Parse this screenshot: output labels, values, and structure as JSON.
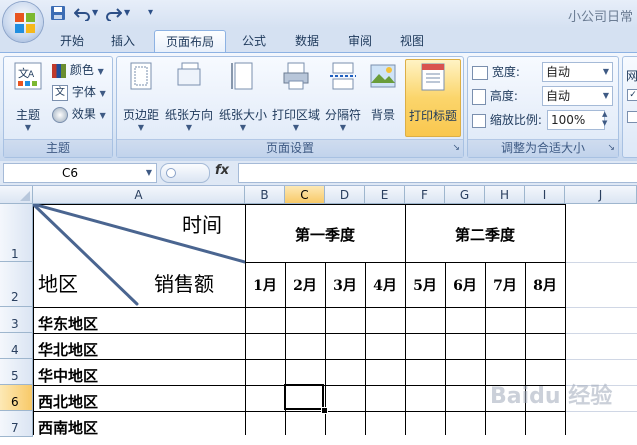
{
  "window": {
    "title": "小公司日常"
  },
  "qat": {
    "save_icon": "save-icon",
    "undo_icon": "undo-icon",
    "redo_icon": "redo-icon",
    "customize_icon": "customize-qat-icon"
  },
  "tabs": [
    {
      "label": "开始"
    },
    {
      "label": "插入"
    },
    {
      "label": "页面布局",
      "active": true
    },
    {
      "label": "公式"
    },
    {
      "label": "数据"
    },
    {
      "label": "审阅"
    },
    {
      "label": "视图"
    }
  ],
  "ribbon": {
    "theme_group": {
      "label": "主题",
      "theme_button": "主题",
      "colors": "颜色",
      "fonts": "字体",
      "effects": "效果"
    },
    "page_setup_group": {
      "label": "页面设置",
      "margins": "页边距",
      "orientation": "纸张方向",
      "size": "纸张大小",
      "print_area": "打印区域",
      "breaks": "分隔符",
      "background": "背景",
      "print_titles": "打印标题"
    },
    "scale_group": {
      "label": "调整为合适大小",
      "width_label": "宽度:",
      "width_value": "自动",
      "height_label": "高度:",
      "height_value": "自动",
      "scale_label": "缩放比例:",
      "scale_value": "100%"
    },
    "sheet_options_group": {
      "label_fragment": "网"
    }
  },
  "formula_bar": {
    "name_box": "C6",
    "fx": "fx",
    "formula": ""
  },
  "sheet": {
    "columns": [
      "A",
      "B",
      "C",
      "D",
      "E",
      "F",
      "G",
      "H",
      "I",
      "J"
    ],
    "selected_column": "C",
    "rows": [
      "1",
      "2",
      "3",
      "4",
      "5",
      "6",
      "7"
    ],
    "selected_row": "6",
    "header_cell": {
      "time": "时间",
      "region": "地区",
      "sales": "销售额"
    },
    "quarters": [
      "第一季度",
      "第二季度"
    ],
    "months": [
      "1月",
      "2月",
      "3月",
      "4月",
      "5月",
      "6月",
      "7月",
      "8月"
    ],
    "regions": [
      "华东地区",
      "华北地区",
      "华中地区",
      "西北地区",
      "西南地区"
    ],
    "active_cell": "C6"
  },
  "watermark": {
    "text": "Baidu 经验"
  }
}
